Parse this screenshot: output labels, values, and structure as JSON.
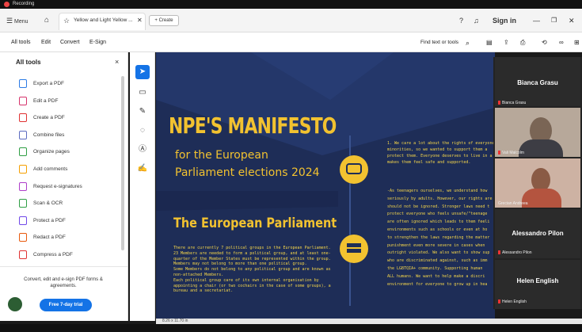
{
  "window": {
    "title": "Recording"
  },
  "tabbar": {
    "menu": "Menu",
    "tab_title": "Yellow and Light Yellow ...",
    "create": "Create",
    "sign_in": "Sign in"
  },
  "menubar": {
    "items": [
      "All tools",
      "Edit",
      "Convert",
      "E-Sign"
    ],
    "search": "Find text or tools"
  },
  "left_panel": {
    "title": "All tools",
    "tools": [
      {
        "label": "Export a PDF",
        "color": "#2c7be5"
      },
      {
        "label": "Edit a PDF",
        "color": "#d6336c"
      },
      {
        "label": "Create a PDF",
        "color": "#e03131"
      },
      {
        "label": "Combine files",
        "color": "#5c6bc0"
      },
      {
        "label": "Organize pages",
        "color": "#2f9e44"
      },
      {
        "label": "Add comments",
        "color": "#f59f00"
      },
      {
        "label": "Request e-signatures",
        "color": "#ae3ec9"
      },
      {
        "label": "Scan & OCR",
        "color": "#2f9e44"
      },
      {
        "label": "Protect a PDF",
        "color": "#7048e8"
      },
      {
        "label": "Redact a PDF",
        "color": "#e8590c"
      },
      {
        "label": "Compress a PDF",
        "color": "#e03131"
      }
    ],
    "promo": "Convert, edit and e-sign PDF forms & agreements.",
    "trial_button": "Free 7-day trial"
  },
  "document": {
    "title": "NPE'S MANIFESTO",
    "subtitle_line1": "for the European",
    "subtitle_line2": "Parliament elections 2024",
    "section_title": "The European Parliament",
    "left_text": [
      "There are currently 7 political groups in the European Parliament.",
      "23 Members are needed to form a political group, and at least one-",
      "quarter of the Member States must be represented within the group.",
      "Members may not belong to more than one political group.",
      "Some Members do not belong to any political group and are known as",
      "non-attached Members.",
      "Each political group care of its own internal organisation by",
      "appointing a chair (or two cochairs in the case of some groups), a",
      "bureau and a secretariat."
    ],
    "right_text_1": [
      "1. We care a lot about the rights of everyone",
      "minorities, so we wanted to support them a",
      "protect them. Everyone deserves to live in a",
      "makes them feel safe and supported."
    ],
    "right_text_2": [
      "-As teenagers ourselves, we understand how",
      "seriously by adults. However, our rights are",
      "should not be ignored. Stronger laws need t",
      "protect everyone who feels unsafe/\"teenage",
      "are often ignored which leads to them feeli",
      "environments such as schools or even at ho",
      "to strengthen the laws regarding the matter",
      "punishment even more severe in cases when",
      "outright violated. We also want to show sup",
      "who are discriminated against, such as imm",
      "the LGBTQIA+ community. Supporting human",
      "ALL humans. We want to help make a discri",
      "environment for everyone to grow up in hea"
    ],
    "page_size": "8.26 x 11.70 in"
  },
  "participants": [
    {
      "name": "Bianca Grasu",
      "tag": "Bianca Grasu"
    },
    {
      "name": "",
      "tag": "Vali Malcolm"
    },
    {
      "name": "",
      "tag": "Grecian Andreea"
    },
    {
      "name": "Alessandro Pilon",
      "tag": "Alessandro Pilon"
    },
    {
      "name": "Helen English",
      "tag": "Helen English"
    }
  ]
}
